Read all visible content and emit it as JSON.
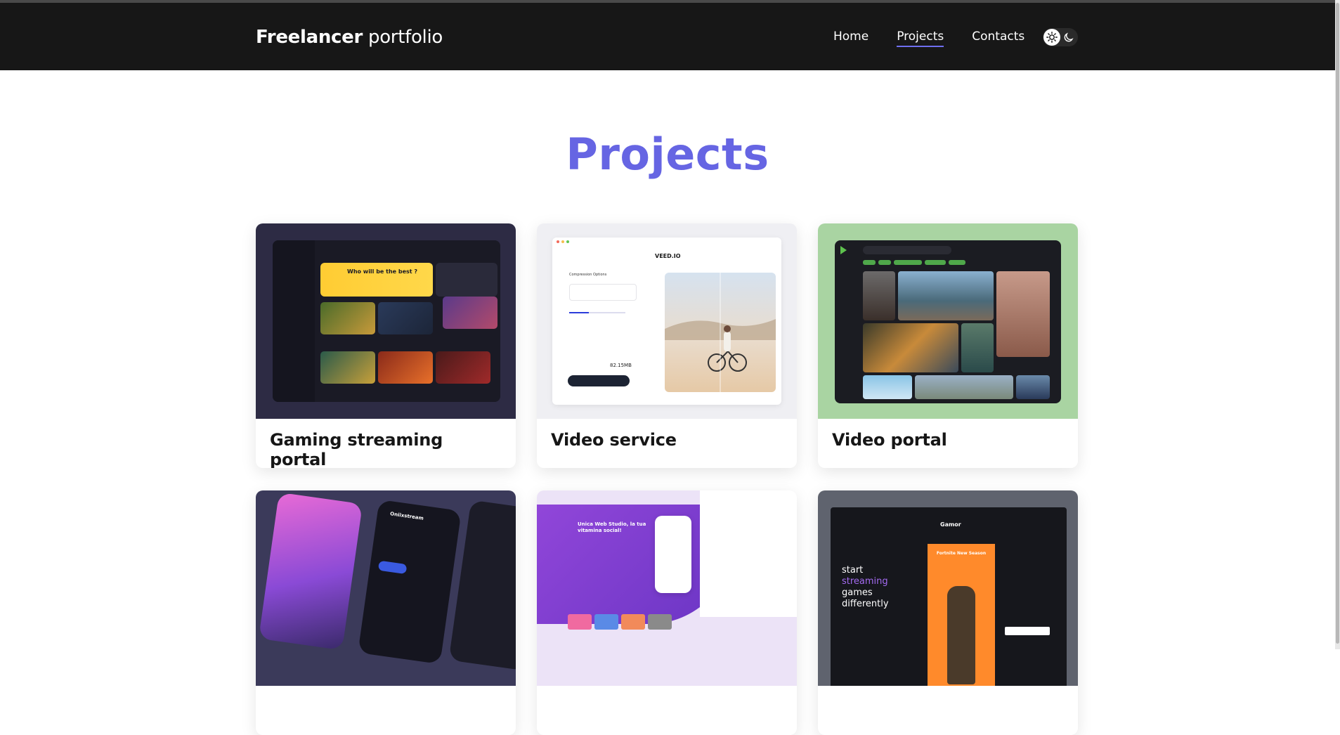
{
  "header": {
    "logo_bold": "Freelancer",
    "logo_light": "portfolio",
    "nav": [
      {
        "label": "Home",
        "active": false
      },
      {
        "label": "Projects",
        "active": true
      },
      {
        "label": "Contacts",
        "active": false
      }
    ],
    "theme_toggle": {
      "left_icon": "sun-icon",
      "right_icon": "moon-icon"
    }
  },
  "page": {
    "title": "Projects",
    "accent_color": "#6665e3"
  },
  "projects": [
    {
      "title": "Gaming streaming portal",
      "thumb_bg": "#2d2b44"
    },
    {
      "title": "Video service",
      "thumb_bg": "#efeff3"
    },
    {
      "title": "Video portal",
      "thumb_bg": "#a9d4a2"
    },
    {
      "title": "",
      "thumb_bg": "#3b3a5a"
    },
    {
      "title": "",
      "thumb_bg": "#ece3f7"
    },
    {
      "title": "",
      "thumb_bg": "#5f636e"
    }
  ],
  "thumbnail_text": {
    "p1_hero": "Who will be the best ?",
    "p2_brand": "VEED.IO",
    "p2_panel": "Compression Options",
    "p2_size": "82.15MB",
    "p4_brand": "Oniixstream",
    "p5_heading": "Unica Web Studio, la tua vitamina social!",
    "p6_brand": "Gamor",
    "p6_headline_1": "start",
    "p6_headline_2": "streaming",
    "p6_headline_3": "games",
    "p6_headline_4": "differently",
    "p6_promo": "Fortnite New Season"
  }
}
